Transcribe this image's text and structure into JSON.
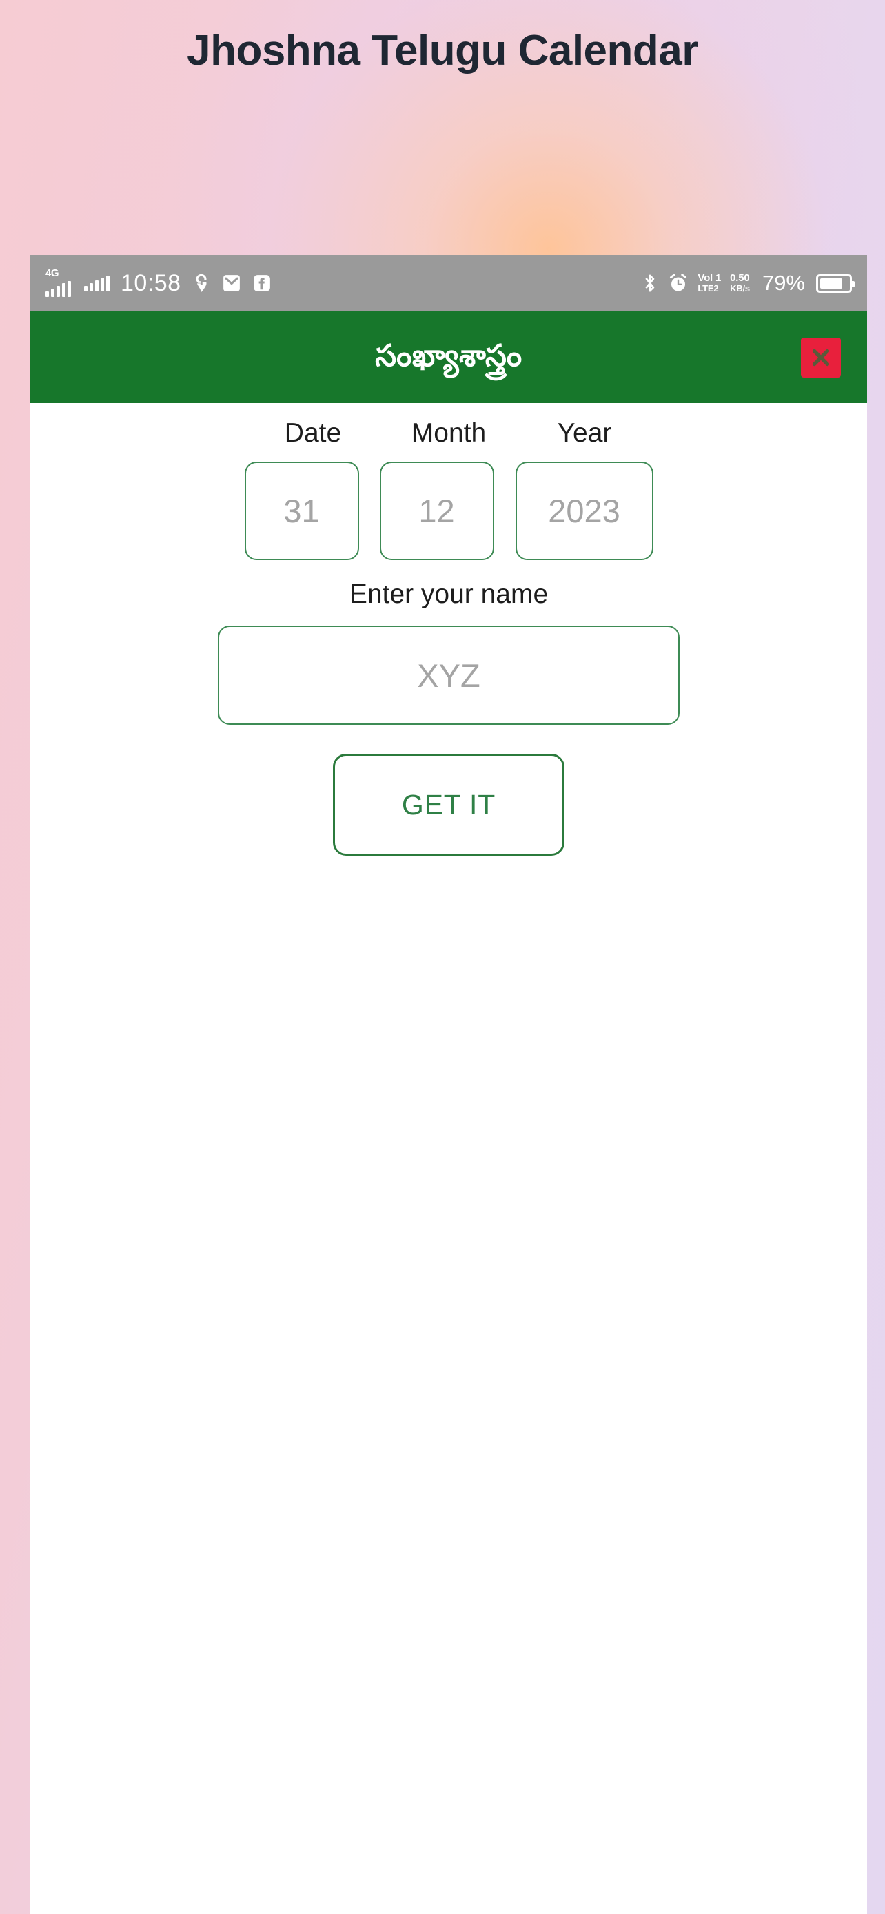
{
  "page": {
    "title": "Jhoshna Telugu Calendar",
    "accent_green": "#17772b",
    "accent_red": "#e8203c",
    "background_pink": "#f6ccd3",
    "background_lavender": "#e4d7f0"
  },
  "status_bar": {
    "network_label": "4G",
    "clock": "10:58",
    "icons_left": [
      "signal-4g-icon",
      "signal-bars-icon",
      "swiggy-icon",
      "mail-icon",
      "facebook-icon"
    ],
    "icons_right": [
      "bluetooth-icon",
      "alarm-icon",
      "volte-icon",
      "data-rate-icon",
      "battery-icon"
    ],
    "volte_line1": "Vol 1",
    "volte_line2": "LTE2",
    "data_rate_value": "0.50",
    "data_rate_unit": "KB/s",
    "battery_percent": "79%"
  },
  "app_bar": {
    "title": "సంఖ్యాశాస్త్రం",
    "close_label": "close-icon"
  },
  "form": {
    "labels": {
      "date": "Date",
      "month": "Month",
      "year": "Year",
      "name": "Enter your name"
    },
    "placeholders": {
      "date": "31",
      "month": "12",
      "year": "2023",
      "name": "XYZ"
    },
    "values": {
      "date": "31",
      "month": "12",
      "year": "2023",
      "name": "XYZ"
    },
    "submit_label": "GET IT"
  }
}
